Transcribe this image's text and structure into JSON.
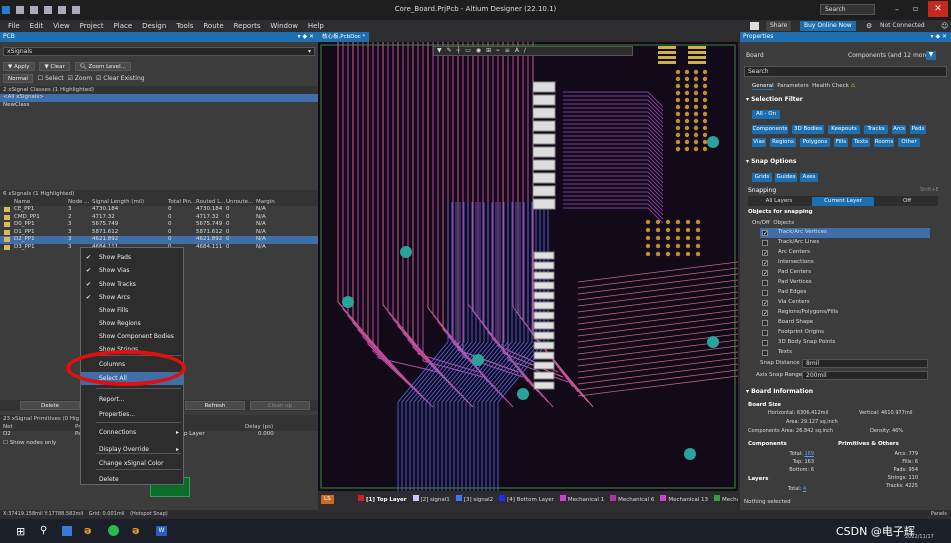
{
  "window": {
    "title": "Core_Board.PrjPcb - Altium Designer (22.10.1)",
    "search": "Search"
  },
  "menu": [
    "File",
    "Edit",
    "View",
    "Project",
    "Place",
    "Design",
    "Tools",
    "Route",
    "Reports",
    "Window",
    "Help"
  ],
  "top_right": {
    "share": "Share",
    "buy": "Buy Online Now",
    "connected": "Not Connected"
  },
  "pcb_panel": {
    "title": "PCB",
    "mode": "xSignals",
    "buttons": [
      "Apply",
      "Clear",
      "Zoom Level..."
    ],
    "filter_mode": "Normal",
    "options": [
      "Select",
      "Zoom",
      "Clear Existing"
    ],
    "classes_header": "2 xSignal Classes (1 Highlighted)",
    "classes": [
      "<All xSignals>",
      "NewClass"
    ],
    "signals_header": "6 xSignals (1 Highlighted)",
    "columns": [
      "Name",
      "Node ...",
      "Signal Length (mil)",
      "Total Pin...",
      "Routed L...",
      "Unroute...",
      "Margin"
    ],
    "rows": [
      [
        "CE_PP1",
        "3",
        "4730.184",
        "0",
        "4730.184",
        "0",
        "N/A"
      ],
      [
        "CMD_PP1",
        "2",
        "4717.32",
        "0",
        "4717.32",
        "0",
        "N/A"
      ],
      [
        "D0_PP1",
        "3",
        "5675.749",
        "0",
        "5675.749",
        "0",
        "N/A"
      ],
      [
        "D1_PP1",
        "3",
        "5871.612",
        "0",
        "5871.612",
        "0",
        "N/A"
      ],
      [
        "D2_PP1",
        "3",
        "4621.892",
        "0",
        "4621.892",
        "0",
        "N/A"
      ],
      [
        "D3_PP1",
        "3",
        "4684.111",
        "0",
        "4684.111",
        "0",
        "N/A"
      ]
    ],
    "highlighted_row": 4,
    "bottom_buttons": [
      "Delete",
      "Refresh",
      "Clean up"
    ],
    "primitives_header": "23 xSignal Primitives (0 Hig",
    "prim_columns": [
      "Net",
      "Pr",
      "Delay (ps)"
    ],
    "prim_row": [
      "D2",
      "Pa",
      "p Layer",
      "0.000"
    ],
    "show_nodes": "Show nodes only"
  },
  "context_menu": {
    "items": [
      {
        "label": "Show Pads",
        "checked": true
      },
      {
        "label": "Show Vias",
        "checked": true
      },
      {
        "label": "Show Tracks",
        "checked": true
      },
      {
        "label": "Show Arcs",
        "checked": true
      },
      {
        "label": "Show Fills",
        "checked": false
      },
      {
        "label": "Show Regions",
        "checked": false
      },
      {
        "label": "Show Component Bodies",
        "checked": false
      },
      {
        "label": "Show Strings",
        "checked": false
      },
      {
        "label": "Columns",
        "checked": false
      },
      {
        "label": "Select All",
        "checked": false
      },
      {
        "label": "Report...",
        "checked": false
      },
      {
        "label": "Properties...",
        "checked": false
      },
      {
        "label": "Connections",
        "checked": false,
        "sub": true
      },
      {
        "label": "Display Override",
        "checked": false,
        "sub": true
      },
      {
        "label": "Change xSignal Color",
        "checked": false
      },
      {
        "label": "Delete",
        "checked": false
      }
    ]
  },
  "doc_tab": "核心板.PcbDoc *",
  "layers": {
    "scope": "LS",
    "items": [
      {
        "label": "[1] Top Layer",
        "color": "#d22020"
      },
      {
        "label": "[2] signal1",
        "color": "#c8c8ff"
      },
      {
        "label": "[3] signal2",
        "color": "#3c78ff"
      },
      {
        "label": "[4] Bottom Layer",
        "color": "#1c2cff"
      },
      {
        "label": "Mechanical 1",
        "color": "#d040d0"
      },
      {
        "label": "Mechanical 6",
        "color": "#b030b0"
      },
      {
        "label": "Mechanical 13",
        "color": "#d040d0"
      },
      {
        "label": "Mechanical 15",
        "color": "#30a040"
      }
    ]
  },
  "properties": {
    "title": "Properties",
    "board": "Board",
    "components": "Components (and 12 more)",
    "search": "Search",
    "tabs": [
      "General",
      "Parameters",
      "Health Check"
    ],
    "selection_filter_title": "Selection Filter",
    "all_on": "All - On",
    "filter_pills": [
      "Components",
      "3D Bodies",
      "Keepouts",
      "Tracks",
      "Arcs",
      "Pads",
      "Vias",
      "Regions",
      "Polygons",
      "Fills",
      "Texts",
      "Rooms",
      "Other"
    ],
    "snap_options_title": "Snap Options",
    "snap_pills": [
      "Grids",
      "Guides",
      "Axes"
    ],
    "snapping": "Snapping",
    "shift": "Shift+E",
    "snap_modes": [
      "All Layers",
      "Current Layer",
      "Off"
    ],
    "objects_title": "Objects for snapping",
    "onoff": "On/Off",
    "objects_col": "Objects",
    "snap_objects": [
      {
        "label": "Track/Arc Vertices",
        "on": true,
        "hl": true
      },
      {
        "label": "Track/Arc Lines",
        "on": false
      },
      {
        "label": "Arc Centers",
        "on": true
      },
      {
        "label": "Intersections",
        "on": true
      },
      {
        "label": "Pad Centers",
        "on": true
      },
      {
        "label": "Pad Vertices",
        "on": false
      },
      {
        "label": "Pad Edges",
        "on": false
      },
      {
        "label": "Via Centers",
        "on": true
      },
      {
        "label": "Regions/Polygons/Fills",
        "on": true
      },
      {
        "label": "Board Shape",
        "on": false
      },
      {
        "label": "Footprint Origins",
        "on": false
      },
      {
        "label": "3D Body Snap Points",
        "on": false
      },
      {
        "label": "Texts",
        "on": false
      }
    ],
    "snap_distance_label": "Snap Distance",
    "snap_distance": "8mil",
    "axis_range_label": "Axis Snap Range",
    "axis_range": "200mil",
    "board_info_title": "Board Information",
    "board_size": "Board Size",
    "horizontal_label": "Horizontal:",
    "horizontal": "6306.412mil",
    "vertical_label": "Vertical:",
    "vertical": "4610.977mil",
    "area_label": "Area:",
    "area": "29.127 sq.inch",
    "comp_area_label": "Components Area:",
    "comp_area": "26.842 sq.inch",
    "density_label": "Density:",
    "density": "46%",
    "components_title": "Components",
    "total_label": "Total:",
    "total": "169",
    "top_label": "Top:",
    "top": "163",
    "bottom_label": "Bottom:",
    "bottom": "6",
    "prims_title": "Primitives & Others",
    "arcs_label": "Arcs:",
    "arcs": "779",
    "fills_label": "Fills:",
    "fills": "6",
    "pads_label": "Pads:",
    "pads": "954",
    "strings_label": "Strings:",
    "strings": "110",
    "tracks_label": "Tracks:",
    "tracks": "4225",
    "layers_title": "Layers",
    "layers_total_label": "Total:",
    "layers_total": "4",
    "nothing_selected": "Nothing selected"
  },
  "status": {
    "coords": "X:37419.158mil Y:17788.582mil",
    "grid": "Grid: 0.001mil",
    "snap": "(Hotspot Snap)",
    "panels": "Panels"
  },
  "taskbar": {
    "watermark": "CSDN @电子辉",
    "date": "2022/11/17"
  }
}
